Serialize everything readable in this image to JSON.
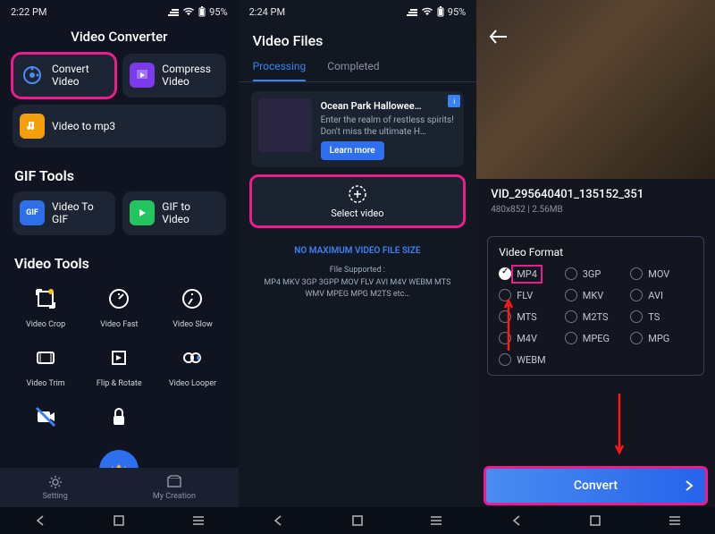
{
  "screen1": {
    "status": {
      "time": "2:22 PM",
      "battery": "95%"
    },
    "title": "Video Converter",
    "tiles": {
      "convert": "Convert Video",
      "compress": "Compress Video",
      "mp3": "Video to mp3"
    },
    "gif_section": "GIF Tools",
    "gif_tiles": {
      "togif": "Video To GIF",
      "tovideo": "GIF to Video"
    },
    "vid_section": "Video Tools",
    "tools": [
      "Video Crop",
      "Video Fast",
      "Video Slow",
      "Video Trim",
      "Flip & Rotate",
      "Video Looper"
    ],
    "nav": {
      "setting": "Setting",
      "creation": "My Creation"
    }
  },
  "screen2": {
    "status": {
      "time": "2:24 PM",
      "battery": "95%"
    },
    "title": "Video Files",
    "tabs": {
      "processing": "Processing",
      "completed": "Completed"
    },
    "ad": {
      "title": "Ocean Park Hallowee…",
      "desc": "Enter the realm of restless spirits! Don't miss the ultimate H…",
      "btn": "Learn more"
    },
    "select": "Select video",
    "nomax": "NO MAXIMUM VIDEO FILE SIZE",
    "supported_h": "File Supported :",
    "supported": "MP4 MKV 3GP 3GPP MOV FLV AVI M4V WEBM MTS WMV MPEG MPG M2TS etc…"
  },
  "screen3": {
    "vid_name": "VID_295640401_135152_351",
    "vid_sub": "480x852   |   2.56MB",
    "format_title": "Video Format",
    "formats": [
      "MP4",
      "3GP",
      "MOV",
      "FLV",
      "MKV",
      "AVI",
      "MTS",
      "M2TS",
      "TS",
      "M4V",
      "MPEG",
      "MPG",
      "WEBM"
    ],
    "convert": "Convert"
  }
}
